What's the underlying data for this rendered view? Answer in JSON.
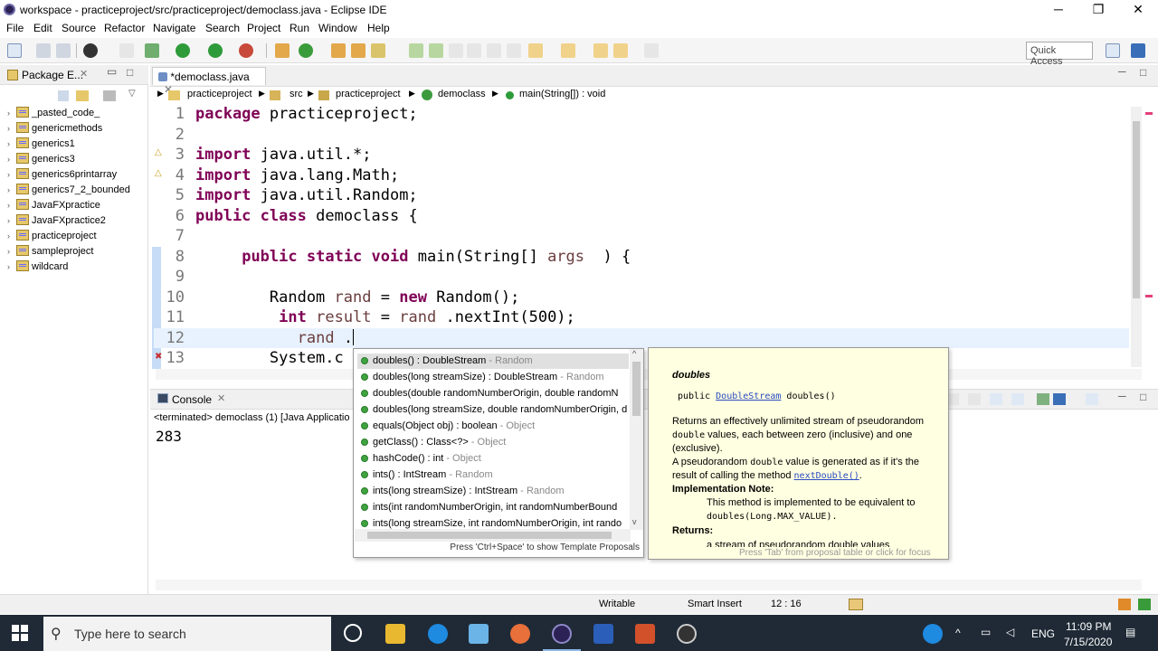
{
  "window": {
    "title": "workspace - practiceproject/src/practiceproject/democlass.java - Eclipse IDE",
    "minimize": "─",
    "restore": "❐",
    "close": "✕"
  },
  "menu": [
    "File",
    "Edit",
    "Source",
    "Refactor",
    "Navigate",
    "Search",
    "Project",
    "Run",
    "Window",
    "Help"
  ],
  "toolbar": {
    "quick_access": "Quick Access"
  },
  "package_explorer": {
    "tab_label": "Package E...",
    "projects": [
      "_pasted_code_",
      "genericmethods",
      "generics1",
      "generics3",
      "generics6printarray",
      "generics7_2_bounded",
      "JavaFXpractice",
      "JavaFXpractice2",
      "practiceproject",
      "sampleproject",
      "wildcard"
    ]
  },
  "editor": {
    "tab_label": "*democlass.java",
    "breadcrumb": [
      "practiceproject",
      "src",
      "practiceproject",
      "democlass",
      "main(String[]) : void"
    ],
    "lines": [
      {
        "n": "1",
        "tokens": [
          [
            "kw",
            "package"
          ],
          [
            "",
            "practiceproject;"
          ]
        ]
      },
      {
        "n": "2",
        "tokens": []
      },
      {
        "n": "3",
        "tokens": [
          [
            "kw",
            "import"
          ],
          [
            "",
            "java.util.*;"
          ]
        ]
      },
      {
        "n": "4",
        "tokens": [
          [
            "kw",
            "import"
          ],
          [
            "",
            "java.lang.Math;"
          ]
        ]
      },
      {
        "n": "5",
        "tokens": [
          [
            "kw",
            "import"
          ],
          [
            "",
            "java.util.Random;"
          ]
        ]
      },
      {
        "n": "6",
        "tokens": [
          [
            "kw",
            "public"
          ],
          [
            "kw",
            "class"
          ],
          [
            "",
            "democlass {"
          ]
        ]
      },
      {
        "n": "7",
        "tokens": []
      },
      {
        "n": "8",
        "tokens": [
          [
            "",
            "    "
          ],
          [
            "kw",
            "public"
          ],
          [
            "kw",
            "static"
          ],
          [
            "kw",
            "void"
          ],
          [
            "",
            "main(String[]"
          ],
          [
            "var",
            "args"
          ],
          [
            "",
            " ) {"
          ]
        ]
      },
      {
        "n": "9",
        "tokens": []
      },
      {
        "n": "10",
        "tokens": [
          [
            "",
            "        Random"
          ],
          [
            "var",
            "rand"
          ],
          [
            "",
            "="
          ],
          [
            "kw",
            "new"
          ],
          [
            "",
            "Random();"
          ]
        ]
      },
      {
        "n": "11",
        "tokens": [
          [
            "",
            "        "
          ],
          [
            "kw",
            "int"
          ],
          [
            "var",
            "result"
          ],
          [
            "",
            "="
          ],
          [
            "var",
            "rand"
          ],
          [
            "",
            ".nextInt(500);"
          ]
        ]
      },
      {
        "n": "12",
        "tokens": [
          [
            "",
            "          "
          ],
          [
            "var",
            "rand"
          ],
          [
            "",
            "."
          ]
        ]
      },
      {
        "n": "13",
        "tokens": [
          [
            "",
            "        System.c"
          ]
        ]
      }
    ]
  },
  "autocomplete": {
    "proposals": [
      {
        "sig": "doubles() : DoubleStream",
        "owner": " - Random"
      },
      {
        "sig": "doubles(long streamSize) : DoubleStream",
        "owner": " - Random"
      },
      {
        "sig": "doubles(double randomNumberOrigin, double randomN",
        "owner": ""
      },
      {
        "sig": "doubles(long streamSize, double randomNumberOrigin, d",
        "owner": ""
      },
      {
        "sig": "equals(Object obj) : boolean",
        "owner": " - Object"
      },
      {
        "sig": "getClass() : Class<?>",
        "owner": " - Object"
      },
      {
        "sig": "hashCode() : int",
        "owner": " - Object"
      },
      {
        "sig": "ints() : IntStream",
        "owner": " - Random"
      },
      {
        "sig": "ints(long streamSize) : IntStream",
        "owner": " - Random"
      },
      {
        "sig": "ints(int randomNumberOrigin, int randomNumberBound",
        "owner": ""
      },
      {
        "sig": "ints(long streamSize, int randomNumberOrigin, int rando",
        "owner": ""
      }
    ],
    "footer": "Press 'Ctrl+Space' to show Template Proposals"
  },
  "doc": {
    "heading": "doubles",
    "signature_prefix": "public ",
    "signature_type": "DoubleStream",
    "signature_rest": " doubles()",
    "para1a": "Returns an effectively unlimited stream of pseudorandom",
    "para1b_mono": "double",
    "para1b": " values, each between zero (inclusive) and one",
    "para1c": "(exclusive).",
    "para2a": "A pseudorandom ",
    "para2a_mono": "double",
    "para2b": " value is generated as if it's the",
    "para2c": "result of calling the method ",
    "para2c_link": "nextDouble()",
    "para2c_end": ".",
    "impl_heading": "Implementation Note:",
    "impl_text": "This method is implemented to be equivalent to",
    "impl_code": "doubles(Long.MAX_VALUE).",
    "returns_heading": "Returns:",
    "returns_text": "a stream of pseudorandom double values",
    "footer": "Press 'Tab' from proposal table or click for focus"
  },
  "console": {
    "tab_label": "Console",
    "status": "<terminated> democlass (1) [Java Applicatio",
    "output": "283"
  },
  "statusbar": {
    "mode": "Writable",
    "insert": "Smart Insert",
    "position": "12 : 16"
  },
  "taskbar": {
    "search_placeholder": "Type here to search",
    "time": "11:09 PM",
    "date": "7/15/2020",
    "lang": "ENG"
  }
}
